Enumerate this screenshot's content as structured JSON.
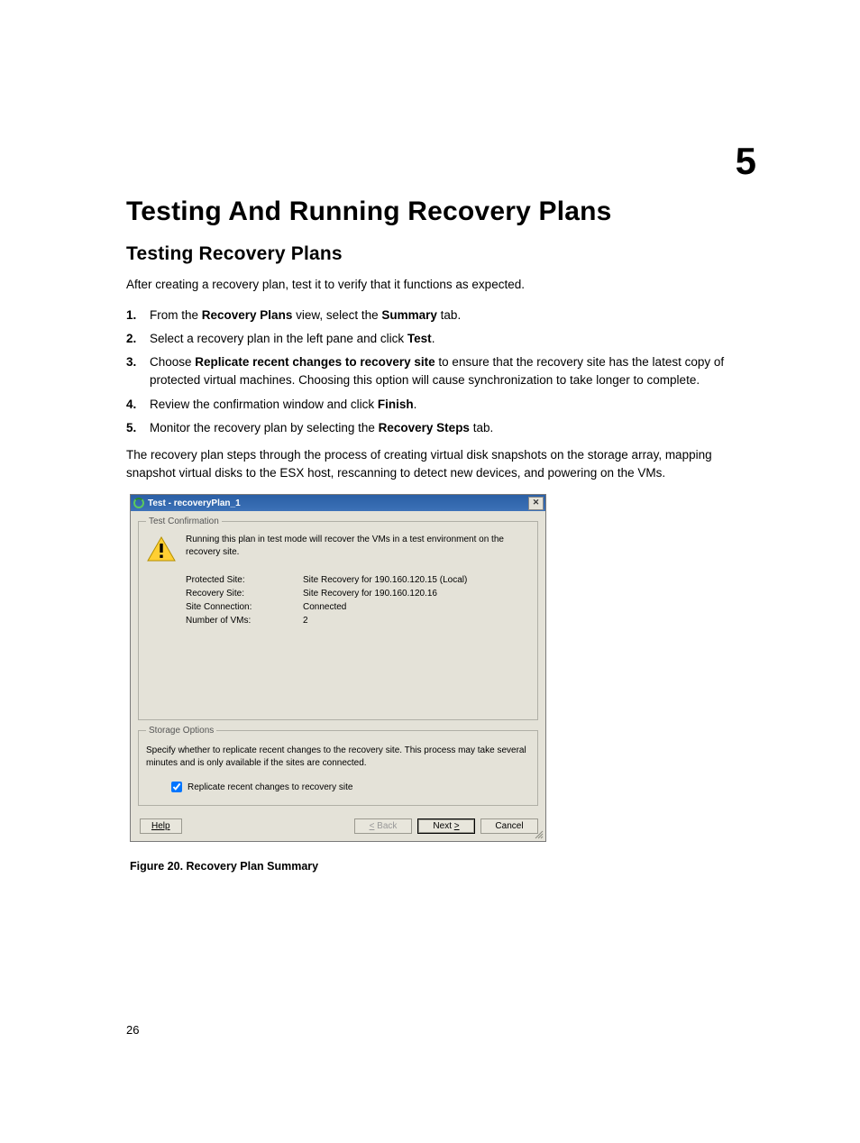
{
  "chapter_number": "5",
  "title": "Testing And Running Recovery Plans",
  "subtitle": "Testing Recovery Plans",
  "intro": "After creating a recovery plan, test it to verify that it functions as expected.",
  "steps": [
    {
      "num": "1.",
      "pre": "From the ",
      "b1": "Recovery Plans",
      "mid": " view, select the ",
      "b2": "Summary",
      "post": " tab."
    },
    {
      "num": "2.",
      "pre": "Select a recovery plan in the left pane and click ",
      "b1": "Test",
      "mid": "",
      "b2": "",
      "post": "."
    },
    {
      "num": "3.",
      "pre": "Choose ",
      "b1": "Replicate recent changes to recovery site",
      "mid": " to ensure that the recovery site has the latest copy of protected virtual machines. Choosing this option will cause synchronization to take longer to complete.",
      "b2": "",
      "post": ""
    },
    {
      "num": "4.",
      "pre": "Review the confirmation window and click ",
      "b1": "Finish",
      "mid": "",
      "b2": "",
      "post": "."
    },
    {
      "num": "5.",
      "pre": "Monitor the recovery plan by selecting the ",
      "b1": "Recovery Steps",
      "mid": "",
      "b2": "",
      "post": " tab."
    }
  ],
  "paragraph": "The recovery plan steps through the process of creating virtual disk snapshots on the storage array, mapping snapshot virtual disks to the ESX host, rescanning to detect new devices, and powering on the VMs.",
  "dialog": {
    "title": "Test - recoveryPlan_1",
    "group1_legend": "Test Confirmation",
    "confirm_text": "Running this plan in test mode will recover the VMs in a test environment on the recovery site.",
    "props": [
      {
        "label": "Protected Site:",
        "value": "Site Recovery for 190.160.120.15 (Local)"
      },
      {
        "label": "Recovery Site:",
        "value": "Site Recovery for 190.160.120.16"
      },
      {
        "label": "Site Connection:",
        "value": "Connected"
      },
      {
        "label": "Number of VMs:",
        "value": "2"
      }
    ],
    "group2_legend": "Storage Options",
    "storage_desc": "Specify whether to replicate recent changes to the recovery site. This process may take several minutes and is only available if the sites are connected.",
    "checkbox_label": "Replicate recent changes to recovery site",
    "checkbox_checked": true,
    "help": "Help",
    "back_u": "<",
    "back": " Back",
    "next": "Next ",
    "next_u": ">",
    "cancel": "Cancel"
  },
  "figure_caption": "Figure 20. Recovery Plan Summary",
  "page_number": "26"
}
